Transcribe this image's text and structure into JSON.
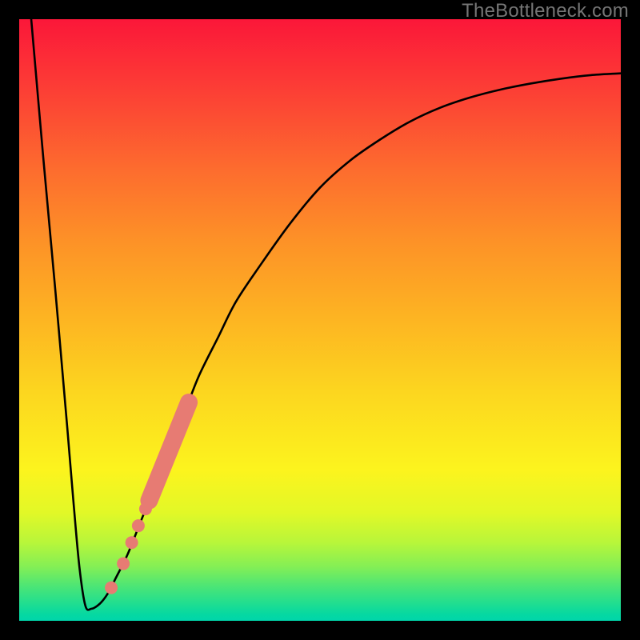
{
  "watermark": "TheBottleneck.com",
  "chart_data": {
    "type": "line",
    "title": "",
    "xlabel": "",
    "ylabel": "",
    "xlim": [
      0,
      100
    ],
    "ylim": [
      0,
      100
    ],
    "grid": false,
    "series": [
      {
        "name": "bottleneck-curve",
        "x": [
          2,
          4,
          6,
          8,
          9,
          10,
          11,
          12,
          13,
          14,
          15,
          16,
          18,
          20,
          22,
          24,
          26,
          28,
          30,
          33,
          36,
          40,
          45,
          50,
          55,
          60,
          65,
          70,
          75,
          80,
          85,
          90,
          95,
          100
        ],
        "y": [
          100,
          77,
          55,
          32,
          20,
          9,
          2.5,
          2,
          2.5,
          3.5,
          5,
          7,
          11,
          16,
          21,
          26,
          31,
          36,
          41,
          47,
          53,
          59,
          66,
          72,
          76.5,
          80,
          83,
          85.3,
          87,
          88.3,
          89.3,
          90.1,
          90.7,
          91
        ]
      }
    ],
    "points": {
      "name": "highlighted-points",
      "color": "#e77b73",
      "items": [
        {
          "x": 15.3,
          "y": 5.5,
          "r": 8
        },
        {
          "x": 17.3,
          "y": 9.5,
          "r": 8
        },
        {
          "x": 18.7,
          "y": 13.0,
          "r": 8
        },
        {
          "x": 19.8,
          "y": 15.8,
          "r": 8
        },
        {
          "x": 21.0,
          "y": 18.6,
          "r": 8
        }
      ],
      "thick_segment": {
        "x0": 21.6,
        "y0": 20.0,
        "x1": 28.2,
        "y1": 36.3,
        "width": 22
      }
    }
  }
}
